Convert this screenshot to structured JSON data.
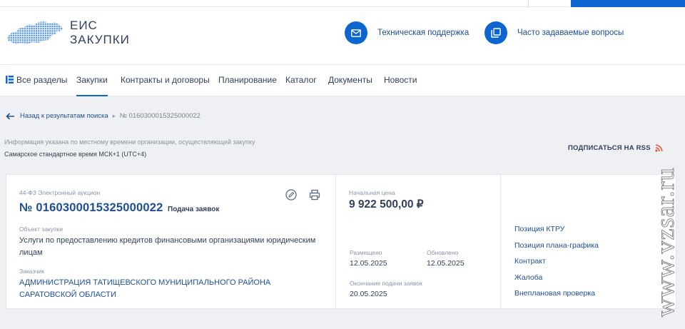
{
  "header": {
    "logo_line1": "ЕИС",
    "logo_line2": "ЗАКУПКИ",
    "support_label": "Техническая поддержка",
    "faq_label": "Часто задаваемые вопросы"
  },
  "nav": {
    "items": [
      "Все разделы",
      "Закупки",
      "Контракты и договоры",
      "Планирование",
      "Каталог",
      "Документы",
      "Новости"
    ],
    "active": "Закупки"
  },
  "breadcrumb": {
    "back": "Назад к результатам поиска",
    "current": "№ 0160300015325000022"
  },
  "info": {
    "note": "Информация указана по местному времени организации, осуществляющей закупку",
    "timezone": "Самарское стандартное время МСК+1 (UTC+4)",
    "rss": "ПОДПИСАТЬСЯ НА RSS"
  },
  "purchase": {
    "law_type": "44-ФЗ Электронный аукцион",
    "number": "№ 0160300015325000022",
    "status": "Подача заявок",
    "object_label": "Объект закупки",
    "object": "Услуги по предоставлению кредитов финансовыми организациями юридическим лицам",
    "customer_label": "Заказчик",
    "customer": "АДМИНИСТРАЦИЯ ТАТИЩЕВСКОГО МУНИЦИПАЛЬНОГО РАЙОНА САРАТОВСКОЙ ОБЛАСТИ",
    "price_label": "Начальная цена",
    "price": "9 922 500,00 ₽",
    "posted_label": "Размещено",
    "posted": "12.05.2025",
    "updated_label": "Обновлено",
    "updated": "12.05.2025",
    "deadline_label": "Окончание подачи заявок",
    "deadline": "20.05.2025"
  },
  "links": [
    "Позиция КТРУ",
    "Позиция плана-графика",
    "Контракт",
    "Жалоба",
    "Внеплановая проверка"
  ],
  "watermark": "www.vzsar.ru",
  "colors": {
    "accent": "#0d66d0",
    "link": "#1d4e99",
    "text": "#334059",
    "muted": "#8a93a3"
  }
}
